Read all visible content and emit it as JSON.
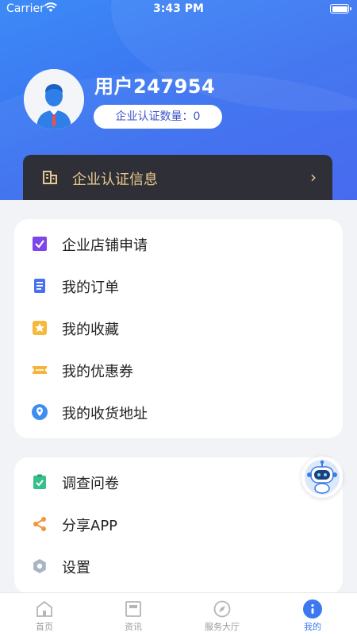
{
  "status_bar": {
    "carrier": "Carrier",
    "time": "3:43 PM"
  },
  "profile": {
    "username": "用户247954",
    "cert_count_label": "企业认证数量：0"
  },
  "cert_bar": {
    "label": "企业认证信息",
    "chevron": "›"
  },
  "menu_primary": [
    {
      "label": "企业店铺申请",
      "icon": "checkbox-icon",
      "color": "#7d46e6"
    },
    {
      "label": "我的订单",
      "icon": "order-doc-icon",
      "color": "#4a6ff0"
    },
    {
      "label": "我的收藏",
      "icon": "star-icon",
      "color": "#f6b93a"
    },
    {
      "label": "我的优惠券",
      "icon": "coupon-icon",
      "color": "#f7b43b"
    },
    {
      "label": "我的收货地址",
      "icon": "location-pin-icon",
      "color": "#3e8ef0"
    }
  ],
  "menu_secondary": [
    {
      "label": "调查问卷",
      "icon": "clipboard-check-icon",
      "color": "#36c08c"
    },
    {
      "label": "分享APP",
      "icon": "share-icon",
      "color": "#f4943a"
    },
    {
      "label": "设置",
      "icon": "gear-icon",
      "color": "#a9b3c2"
    }
  ],
  "tabbar": [
    {
      "label": "首页",
      "icon": "home-icon",
      "active": false
    },
    {
      "label": "资讯",
      "icon": "news-icon",
      "active": false
    },
    {
      "label": "服务大厅",
      "icon": "compass-icon",
      "active": false
    },
    {
      "label": "我的",
      "icon": "profile-icon",
      "active": true
    }
  ],
  "colors": {
    "accent": "#3c78f1",
    "gold": "#e9c88e",
    "header": "#3a6ff0"
  }
}
